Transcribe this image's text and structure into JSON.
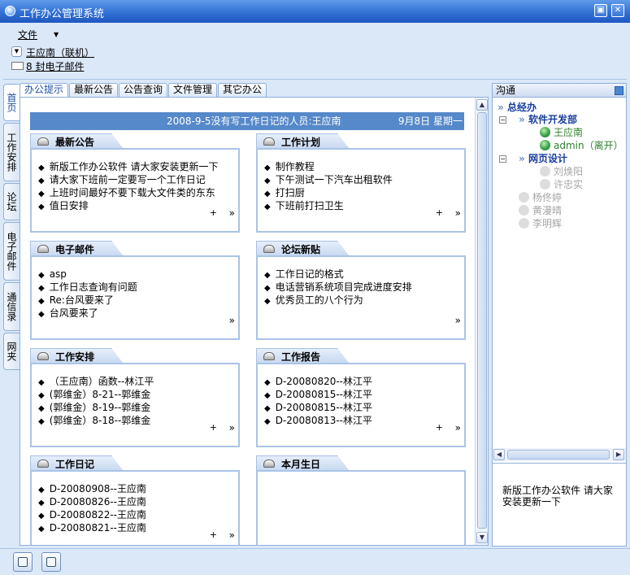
{
  "window": {
    "title": "工作办公管理系统",
    "min_btn": "▣",
    "close_btn": "✕"
  },
  "menu": {
    "file": "文件",
    "arrow": "▼"
  },
  "user": {
    "name": "王应南（联机）",
    "dropdown_glyph": "▼"
  },
  "mail": {
    "text": "8 封电子邮件"
  },
  "left_tabs": [
    "首页",
    "工作安排",
    "论坛",
    "电子邮件",
    "通信录",
    "网夹"
  ],
  "tabs": [
    "办公提示",
    "最新公告",
    "公告查询",
    "文件管理",
    "其它办公"
  ],
  "banner": {
    "left": "2008-9-5没有写工作日记的人员:王应南",
    "right": "9月8日  星期一"
  },
  "sections": {
    "announcements": {
      "title": "最新公告",
      "items": [
        "新版工作办公软件 请大家安装更新一下",
        "请大家下班前一定要写一个工作日记",
        "上班时间最好不要下载大文件类的东东",
        "值日安排"
      ],
      "plus": "+",
      "more": "»"
    },
    "work_plan": {
      "title": "工作计划",
      "items": [
        "制作教程",
        "下午测试一下汽车出租软件",
        "打扫厨",
        "下班前打扫卫生"
      ],
      "plus": "+",
      "more": "»"
    },
    "email": {
      "title": "电子邮件",
      "items": [
        "asp",
        "工作日志查询有问题",
        "Re:台风要来了",
        "台风要来了"
      ],
      "more": "»"
    },
    "forum": {
      "title": "论坛新贴",
      "items": [
        "工作日记的格式",
        "电话营销系统项目完成进度安排",
        "优秀员工的八个行为"
      ],
      "more": "»"
    },
    "schedule": {
      "title": "工作安排",
      "items": [
        "（王应南）函数--林江平",
        "(郭维金）8-21--郭维金",
        "(郭维金）8-19--郭维金",
        "(郭维金）8-18--郭维金"
      ],
      "plus": "+",
      "more": "»"
    },
    "reports": {
      "title": "工作报告",
      "items": [
        "D-20080820--林江平",
        "D-20080815--林江平",
        "D-20080815--林江平",
        "D-20080813--林江平"
      ],
      "plus": "+",
      "more": "»"
    },
    "diary": {
      "title": "工作日记",
      "items": [
        "D-20080908--王应南",
        "D-20080826--王应南",
        "D-20080822--王应南",
        "D-20080821--王应南"
      ],
      "plus": "+",
      "more": "»"
    },
    "birthdays": {
      "title": "本月生日",
      "items": []
    }
  },
  "right_panel": {
    "title": "沟通",
    "tree": {
      "root": "总经办",
      "dept1": {
        "name": "软件开发部",
        "members": [
          "王应南",
          "admin（离开）"
        ]
      },
      "dept2": {
        "name": "网页设计",
        "members": [
          "刘焕阳",
          "许忠实"
        ]
      },
      "others": [
        "杨佟婷",
        "黄漫晴",
        "李明辉"
      ]
    },
    "message": "新版工作办公软件 请大家安装更新一下"
  },
  "colors": {
    "banner": "#5689c9",
    "online": "#3da14a",
    "dept": "#1a3fa0",
    "offline": "#a6a6a6"
  }
}
